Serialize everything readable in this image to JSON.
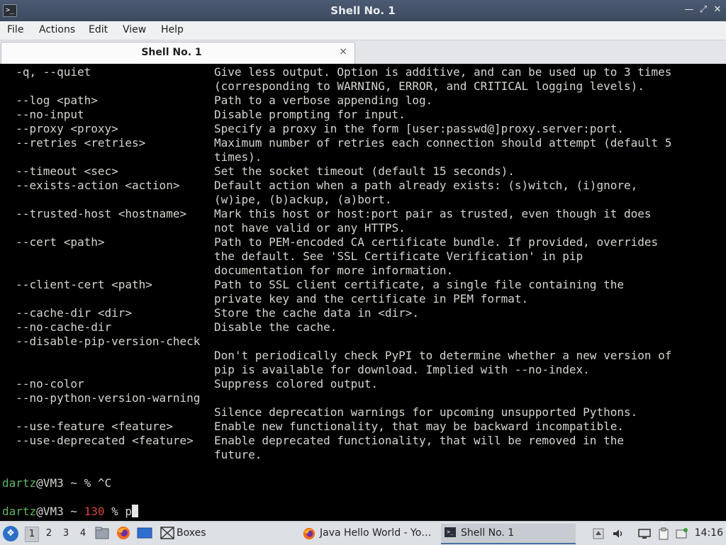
{
  "window": {
    "title": "Shell No. 1",
    "app_icon": "terminal-icon",
    "controls": [
      "minimize-icon",
      "maximize-icon",
      "close-icon"
    ]
  },
  "menu": [
    "File",
    "Actions",
    "Edit",
    "View",
    "Help"
  ],
  "tabs": [
    {
      "label": "Shell No. 1",
      "close": "×"
    }
  ],
  "terminal": {
    "lines": [
      {
        "opt": "  -q, --quiet",
        "desc": "Give less output. Option is additive, and can be used up to 3 times"
      },
      {
        "opt": "",
        "desc": "(corresponding to WARNING, ERROR, and CRITICAL logging levels)."
      },
      {
        "opt": "  --log <path>",
        "desc": "Path to a verbose appending log."
      },
      {
        "opt": "  --no-input",
        "desc": "Disable prompting for input."
      },
      {
        "opt": "  --proxy <proxy>",
        "desc": "Specify a proxy in the form [user:passwd@]proxy.server:port."
      },
      {
        "opt": "  --retries <retries>",
        "desc": "Maximum number of retries each connection should attempt (default 5"
      },
      {
        "opt": "",
        "desc": "times)."
      },
      {
        "opt": "  --timeout <sec>",
        "desc": "Set the socket timeout (default 15 seconds)."
      },
      {
        "opt": "  --exists-action <action>",
        "desc": "Default action when a path already exists: (s)witch, (i)gnore,"
      },
      {
        "opt": "",
        "desc": "(w)ipe, (b)ackup, (a)bort."
      },
      {
        "opt": "  --trusted-host <hostname>",
        "desc": "Mark this host or host:port pair as trusted, even though it does"
      },
      {
        "opt": "",
        "desc": "not have valid or any HTTPS."
      },
      {
        "opt": "  --cert <path>",
        "desc": "Path to PEM-encoded CA certificate bundle. If provided, overrides"
      },
      {
        "opt": "",
        "desc": "the default. See 'SSL Certificate Verification' in pip"
      },
      {
        "opt": "",
        "desc": "documentation for more information."
      },
      {
        "opt": "  --client-cert <path>",
        "desc": "Path to SSL client certificate, a single file containing the"
      },
      {
        "opt": "",
        "desc": "private key and the certificate in PEM format."
      },
      {
        "opt": "  --cache-dir <dir>",
        "desc": "Store the cache data in <dir>."
      },
      {
        "opt": "  --no-cache-dir",
        "desc": "Disable the cache."
      },
      {
        "opt": "  --disable-pip-version-check",
        "desc": ""
      },
      {
        "opt": "",
        "desc": "Don't periodically check PyPI to determine whether a new version of"
      },
      {
        "opt": "",
        "desc": "pip is available for download. Implied with --no-index."
      },
      {
        "opt": "  --no-color",
        "desc": "Suppress colored output."
      },
      {
        "opt": "  --no-python-version-warning",
        "desc": ""
      },
      {
        "opt": "",
        "desc": "Silence deprecation warnings for upcoming unsupported Pythons."
      },
      {
        "opt": "  --use-feature <feature>",
        "desc": "Enable new functionality, that may be backward incompatible."
      },
      {
        "opt": "  --use-deprecated <feature>",
        "desc": "Enable deprecated functionality, that will be removed in the"
      },
      {
        "opt": "",
        "desc": "future."
      },
      {
        "opt": "",
        "desc": ""
      }
    ],
    "prompt1": {
      "user": "dartz",
      "host": "@VM3 ~ ",
      "sym": "% ",
      "text": "^C"
    },
    "prompt2": {
      "user": "dartz",
      "host": "@VM3 ~ ",
      "code": "130",
      "sym": " % ",
      "text": "p"
    }
  },
  "taskbar": {
    "start_icon": "start-menu-icon",
    "workspaces": [
      "1",
      "2",
      "3",
      "4"
    ],
    "active_workspace": "1",
    "quick_launch": [
      "file-manager-icon",
      "firefox-icon",
      "desktop-icon"
    ],
    "boxes_label": "Boxes",
    "tasks": [
      {
        "label": "Java Hello World - Yo…",
        "icon": "firefox-icon",
        "active": false
      },
      {
        "label": "Shell No. 1",
        "icon": "terminal-icon",
        "active": true
      }
    ],
    "tray": [
      "network-icon",
      "volume-icon",
      "display-icon",
      "clipboard-icon",
      "monitor-icon"
    ],
    "clock": "14:16"
  }
}
